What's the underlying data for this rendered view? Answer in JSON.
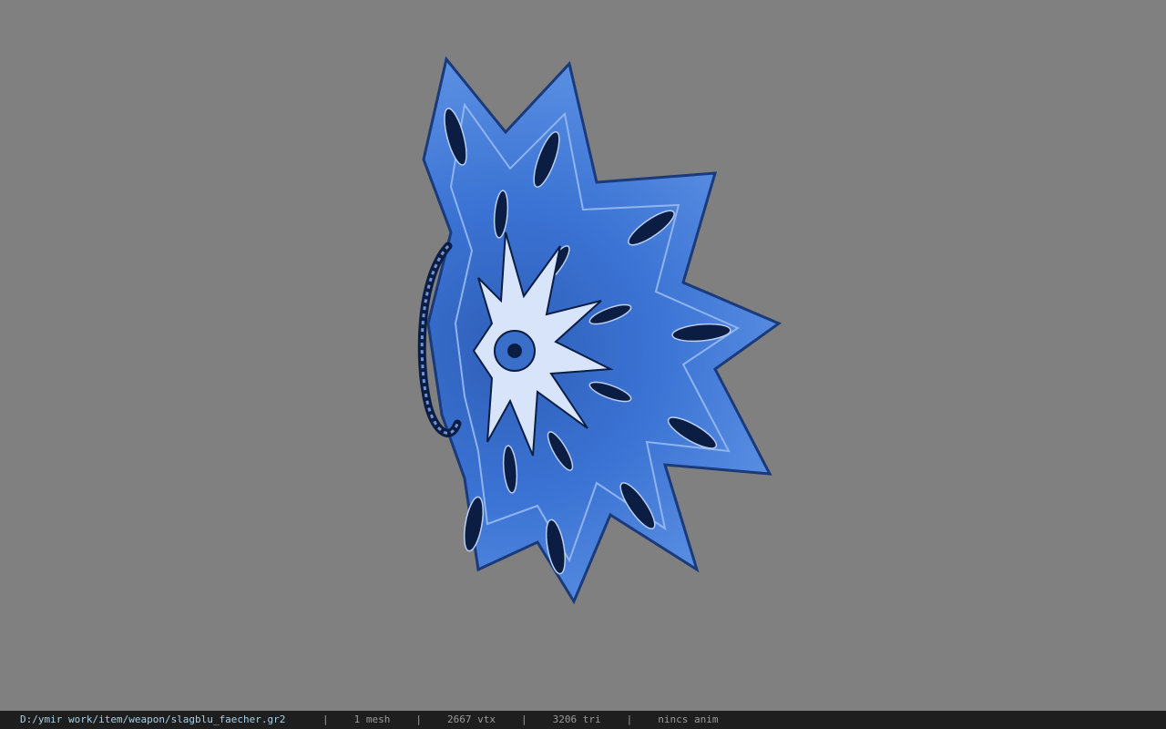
{
  "viewer": {
    "background_color": "#808080",
    "model_name": "fan-weapon-model"
  },
  "status": {
    "path": "D:/ymir work/item/weapon/slagblu_faecher.gr2",
    "separator": "|",
    "mesh": "1 mesh",
    "vtx": "2667 vtx",
    "tri": "3206 tri",
    "anim": "nincs anim"
  }
}
